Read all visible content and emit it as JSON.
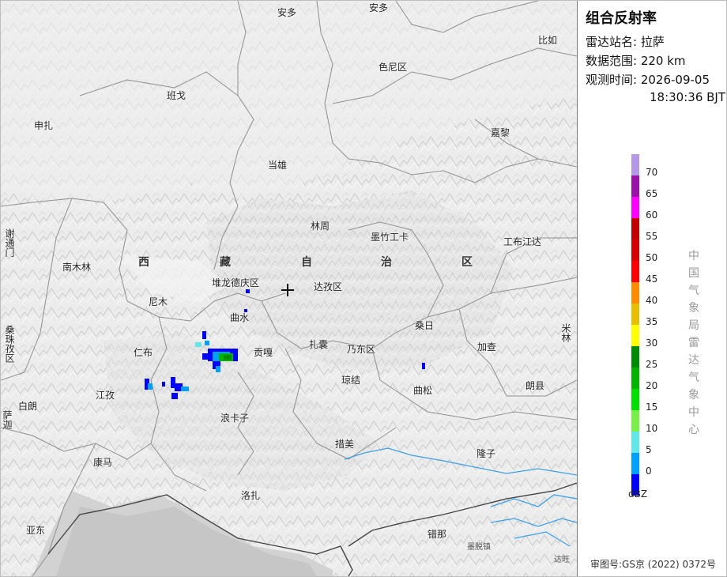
{
  "panel": {
    "title": "组合反射率",
    "station_label": "雷达站名:",
    "station_value": "拉萨",
    "range_label": "数据范围:",
    "range_value": "220 km",
    "time_label": "观测时间:",
    "time_date": "2026-09-05",
    "time_clock": "18:30:36 BJT",
    "unit": "dBZ",
    "org_text": "中国气象局雷达气象中心",
    "footer": "审图号:GS京 (2022) 0372号"
  },
  "legend": {
    "colors": [
      "#b497e6",
      "#9b10a8",
      "#ff00ff",
      "#c20000",
      "#d60000",
      "#ff0000",
      "#ff8c00",
      "#e8be00",
      "#ffff00",
      "#008c00",
      "#00b400",
      "#00e000",
      "#78f048",
      "#60e8e8",
      "#00a0ff",
      "#0000ff"
    ],
    "ticks": [
      "70",
      "65",
      "60",
      "55",
      "50",
      "45",
      "40",
      "35",
      "30",
      "25",
      "20",
      "15",
      "10",
      "5",
      "0"
    ]
  },
  "provinces": [
    "西",
    "藏",
    "自",
    "治",
    "区"
  ],
  "places": {
    "anduo1": "安多",
    "anduo2": "安多",
    "biru": "比如",
    "seni": "色尼区",
    "bange": "班戈",
    "shenzha": "申扎",
    "jiali": "嘉黎",
    "dangxiong": "当雄",
    "linzhou": "林周",
    "mozhu": "墨竹工卡",
    "gongbu": "工布江达",
    "xietong": "谢通门",
    "nanmulin": "南木林",
    "duilong": "堆龙德庆区",
    "dazi": "达孜区",
    "nimu": "尼木",
    "qushui": "曲水",
    "sangri": "桑日",
    "sangzhu": "桑珠孜区",
    "renbu": "仁布",
    "gongga": "贡嘎",
    "zhanang": "扎囊",
    "naidong": "乃东区",
    "jiacha": "加查",
    "milin": "米林",
    "jiangzi": "江孜",
    "qiongjie": "琼结",
    "qusong": "曲松",
    "langxian": "朗县",
    "bailang": "白朗",
    "sajia": "萨迦",
    "langkazi": "浪卡子",
    "cuomei": "措美",
    "longzi": "隆子",
    "kangma": "康马",
    "luozha": "洛扎",
    "yadong": "亚东",
    "cuona": "错那",
    "wm1": "墨脱镇",
    "wm2": "达旺"
  }
}
